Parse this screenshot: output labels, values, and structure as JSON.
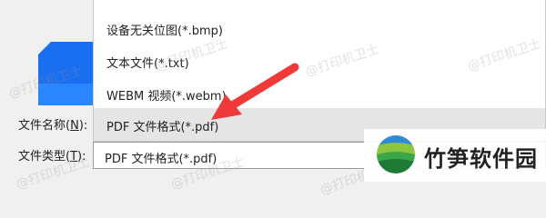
{
  "form": {
    "filename_label_prefix": "文件名称(",
    "filename_label_key": "N",
    "filename_label_suffix": "):",
    "type_label_prefix": "文件类型(",
    "type_label_key": "T",
    "type_label_suffix": "):",
    "selected_type": "PDF 文件格式(*.pdf)"
  },
  "dropdown": {
    "options": [
      {
        "label": "设备无关位图(*.bmp)"
      },
      {
        "label": "文本文件(*.txt)"
      },
      {
        "label": "WEBM 视频(*.webm)"
      },
      {
        "label": "PDF 文件格式(*.pdf)",
        "selected": true
      }
    ]
  },
  "watermark": {
    "text": "@打印机卫士"
  },
  "logo": {
    "name": "竹笋软件园"
  },
  "colors": {
    "file_icon": "#1a6ef0",
    "arrow": "#f03a3a",
    "selected_bg": "#e5e5e5"
  }
}
